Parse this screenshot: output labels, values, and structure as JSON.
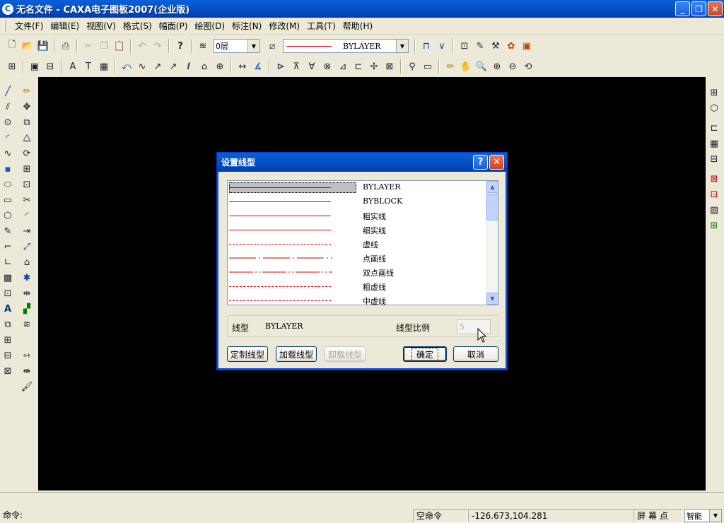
{
  "window": {
    "title": "无名文件 - CAXA电子图板2007(企业版)",
    "app_icon": "caxa-logo-icon"
  },
  "menubar": {
    "items": [
      "文件(F)",
      "编辑(E)",
      "视图(V)",
      "格式(S)",
      "幅面(P)",
      "绘图(D)",
      "标注(N)",
      "修改(M)",
      "工具(T)",
      "帮助(H)"
    ]
  },
  "toolbar": {
    "layer_value": "0层",
    "linetype_value": "BYLAYER"
  },
  "dialog": {
    "title": "设置线型",
    "linetypes": [
      {
        "name": "BYLAYER",
        "style": "solid-thin",
        "selected": true
      },
      {
        "name": "BYBLOCK",
        "style": "solid-thin",
        "selected": false
      },
      {
        "name": "粗实线",
        "style": "solid-thin",
        "selected": false
      },
      {
        "name": "细实线",
        "style": "solid-thin",
        "selected": false
      },
      {
        "name": "虚线",
        "style": "dashed",
        "selected": false
      },
      {
        "name": "点画线",
        "style": "dash-dot",
        "selected": false
      },
      {
        "name": "双点画线",
        "style": "dash-dot-dot",
        "selected": false
      },
      {
        "name": "粗虚线",
        "style": "dashed",
        "selected": false
      },
      {
        "name": "中虚线",
        "style": "dashed",
        "selected": false
      }
    ],
    "linetype_label": "线型",
    "linetype_value": "BYLAYER",
    "scale_label": "线型比例",
    "scale_value": "5",
    "buttons": {
      "custom": "定制线型",
      "load": "加载线型",
      "unload": "卸载线型",
      "ok": "确定",
      "cancel": "取消"
    }
  },
  "statusbar": {
    "command_prompt": "命令:",
    "command_state": "空命令",
    "coordinates": "-126.673,104.281",
    "snap_label": "屏幕点",
    "snap_mode": "智能"
  },
  "colors": {
    "line_red": "#e00000",
    "canvas": "#000000",
    "xp_blue": "#0a5fd8"
  }
}
